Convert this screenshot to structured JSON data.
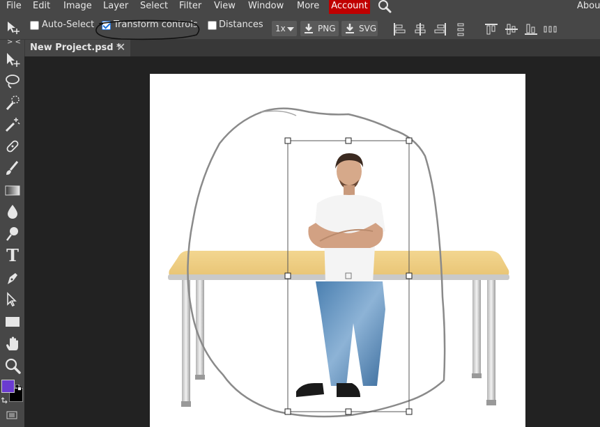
{
  "menu": {
    "items": [
      "File",
      "Edit",
      "Image",
      "Layer",
      "Select",
      "Filter",
      "View",
      "Window",
      "More"
    ],
    "account": "Account",
    "about": "About"
  },
  "options": {
    "auto_select_label": "Auto-Select",
    "auto_select_checked": false,
    "transform_controls_label": "Transform controls",
    "transform_controls_checked": true,
    "distances_label": "Distances",
    "distances_checked": false,
    "zoom_value": "1x",
    "export_png_label": "PNG",
    "export_svg_label": "SVG"
  },
  "tab": {
    "title": "New Project.psd *",
    "close_glyph": "✕"
  },
  "toolbar": {
    "collapse_glyph": "> <",
    "tools": [
      "move-tool",
      "lasso-tool",
      "quick-select-tool",
      "magic-wand-tool",
      "healing-brush-tool",
      "brush-tool",
      "gradient-tool",
      "blur-tool",
      "dodge-tool",
      "type-tool",
      "pen-tool",
      "path-select-tool",
      "rectangle-tool",
      "hand-tool",
      "zoom-tool"
    ],
    "text_tool_glyph": "T"
  },
  "colors": {
    "foreground": "#6a3bd1",
    "background": "#000000",
    "account_bg": "#c00000"
  }
}
